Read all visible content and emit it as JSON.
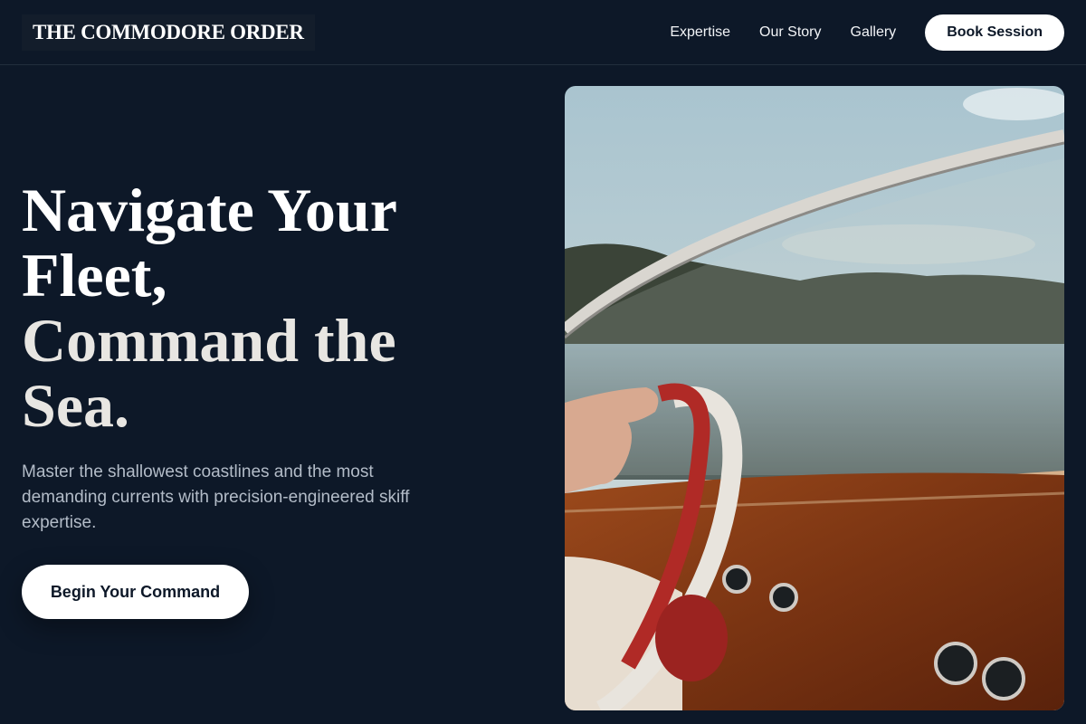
{
  "brand": {
    "name": "THE COMMODORE ORDER"
  },
  "nav": {
    "links": [
      "Expertise",
      "Our Story",
      "Gallery"
    ],
    "book_label": "Book Session"
  },
  "hero": {
    "title_line1": "Navigate Your Fleet,",
    "title_line2": "Command the Sea.",
    "subtitle": "Master the shallowest coastlines and the most demanding currents with precision-engineered skiff expertise.",
    "cta_label": "Begin Your Command"
  },
  "image": {
    "subject": "hand-on-boat-steering-wheel",
    "colors": {
      "sky": "#a9c4cf",
      "wood": "#8a3e16",
      "wheel": "#b02a26",
      "chrome": "#d9d6d0"
    }
  },
  "colors": {
    "background": "#0d1828",
    "text": "#ffffff",
    "muted": "#b3bcc8",
    "button": "#ffffff"
  }
}
